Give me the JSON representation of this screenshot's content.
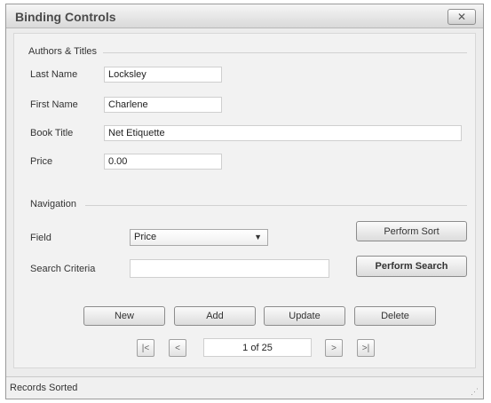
{
  "window": {
    "title": "Binding Controls",
    "close_icon": "close-icon"
  },
  "authors_section": {
    "heading": "Authors & Titles",
    "last_name": {
      "label": "Last Name",
      "value": "Locksley"
    },
    "first_name": {
      "label": "First Name",
      "value": "Charlene"
    },
    "book_title": {
      "label": "Book Title",
      "value": "Net Etiquette"
    },
    "price": {
      "label": "Price",
      "value": "0.00"
    }
  },
  "navigation_section": {
    "heading": "Navigation",
    "field_label": "Field",
    "field_selected": "Price",
    "search_label": "Search Criteria",
    "search_value": "",
    "sort_button": "Perform Sort",
    "search_button": "Perform Search"
  },
  "actions": {
    "new": "New",
    "add": "Add",
    "update": "Update",
    "delete": "Delete"
  },
  "pager": {
    "first": "|<",
    "prev": "<",
    "position": "1 of 25",
    "next": ">",
    "last": ">|"
  },
  "status": {
    "text": "Records Sorted"
  }
}
